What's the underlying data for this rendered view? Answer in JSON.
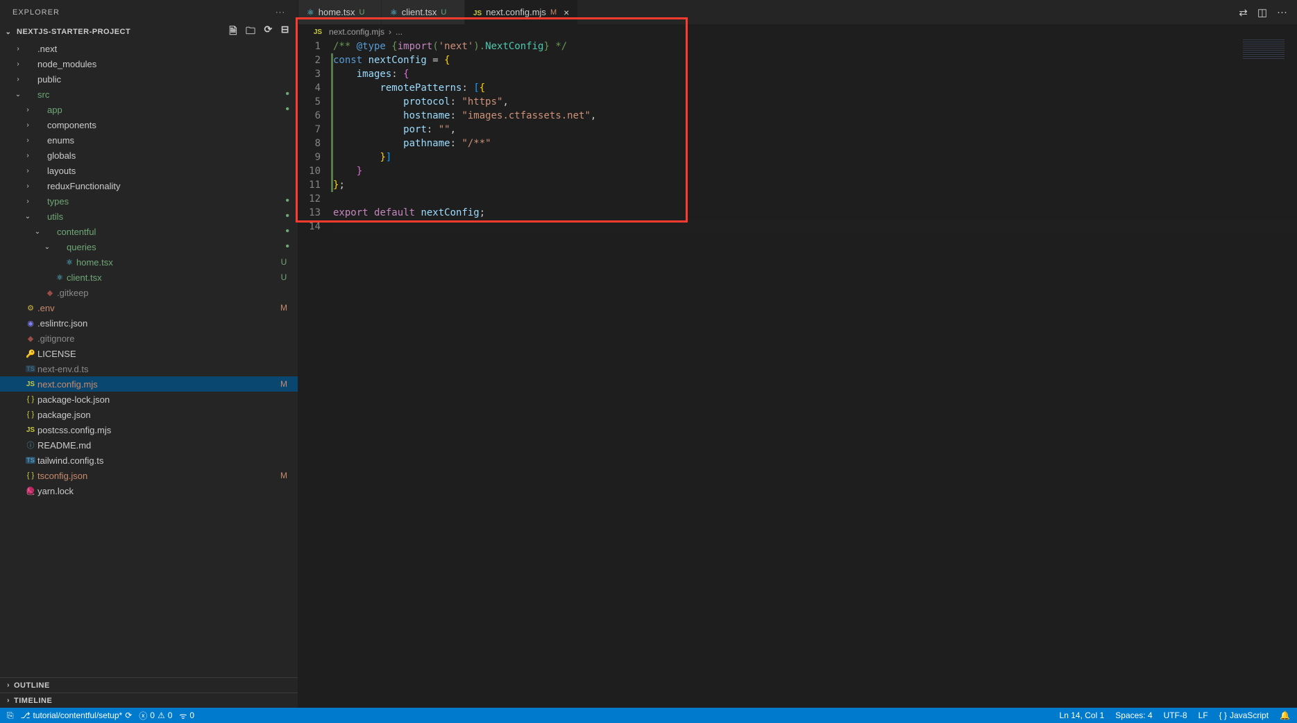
{
  "explorer": {
    "title": "EXPLORER"
  },
  "project": {
    "name": "NEXTJS-STARTER-PROJECT"
  },
  "tree": [
    {
      "indent": 1,
      "chev": "›",
      "icon": "",
      "label": ".next",
      "badge": "",
      "dot": false
    },
    {
      "indent": 1,
      "chev": "›",
      "icon": "",
      "label": "node_modules",
      "badge": "",
      "dot": false
    },
    {
      "indent": 1,
      "chev": "›",
      "icon": "",
      "label": "public",
      "badge": "",
      "dot": false
    },
    {
      "indent": 1,
      "chev": "⌄",
      "icon": "",
      "label": "src",
      "badge": "",
      "dot": true
    },
    {
      "indent": 2,
      "chev": "›",
      "icon": "",
      "label": "app",
      "badge": "",
      "dot": true
    },
    {
      "indent": 2,
      "chev": "›",
      "icon": "",
      "label": "components",
      "badge": "",
      "dot": false
    },
    {
      "indent": 2,
      "chev": "›",
      "icon": "",
      "label": "enums",
      "badge": "",
      "dot": false
    },
    {
      "indent": 2,
      "chev": "›",
      "icon": "",
      "label": "globals",
      "badge": "",
      "dot": false
    },
    {
      "indent": 2,
      "chev": "›",
      "icon": "",
      "label": "layouts",
      "badge": "",
      "dot": false
    },
    {
      "indent": 2,
      "chev": "›",
      "icon": "",
      "label": "reduxFunctionality",
      "badge": "",
      "dot": false
    },
    {
      "indent": 2,
      "chev": "›",
      "icon": "",
      "label": "types",
      "badge": "",
      "dot": true
    },
    {
      "indent": 2,
      "chev": "⌄",
      "icon": "",
      "label": "utils",
      "badge": "",
      "dot": true
    },
    {
      "indent": 3,
      "chev": "⌄",
      "icon": "",
      "label": "contentful",
      "badge": "",
      "dot": true
    },
    {
      "indent": 4,
      "chev": "⌄",
      "icon": "",
      "label": "queries",
      "badge": "",
      "dot": true
    },
    {
      "indent": 5,
      "chev": "",
      "icon": "react",
      "label": "home.tsx",
      "badge": "U",
      "dot": false
    },
    {
      "indent": 4,
      "chev": "",
      "icon": "react",
      "label": "client.tsx",
      "badge": "U",
      "dot": false
    },
    {
      "indent": 3,
      "chev": "",
      "icon": "git",
      "label": ".gitkeep",
      "badge": "",
      "dot": false,
      "muted": true
    },
    {
      "indent": 1,
      "chev": "",
      "icon": "env",
      "label": ".env",
      "badge": "M",
      "dot": false
    },
    {
      "indent": 1,
      "chev": "",
      "icon": "eslint",
      "label": ".eslintrc.json",
      "badge": "",
      "dot": false
    },
    {
      "indent": 1,
      "chev": "",
      "icon": "git",
      "label": ".gitignore",
      "badge": "",
      "dot": false,
      "muted": true
    },
    {
      "indent": 1,
      "chev": "",
      "icon": "lic",
      "label": "LICENSE",
      "badge": "",
      "dot": false
    },
    {
      "indent": 1,
      "chev": "",
      "icon": "ts",
      "label": "next-env.d.ts",
      "badge": "",
      "dot": false,
      "muted": true
    },
    {
      "indent": 1,
      "chev": "",
      "icon": "js",
      "label": "next.config.mjs",
      "badge": "M",
      "dot": false,
      "selected": true
    },
    {
      "indent": 1,
      "chev": "",
      "icon": "json",
      "label": "package-lock.json",
      "badge": "",
      "dot": false
    },
    {
      "indent": 1,
      "chev": "",
      "icon": "json",
      "label": "package.json",
      "badge": "",
      "dot": false
    },
    {
      "indent": 1,
      "chev": "",
      "icon": "js",
      "label": "postcss.config.mjs",
      "badge": "",
      "dot": false
    },
    {
      "indent": 1,
      "chev": "",
      "icon": "md",
      "label": "README.md",
      "badge": "",
      "dot": false
    },
    {
      "indent": 1,
      "chev": "",
      "icon": "ts",
      "label": "tailwind.config.ts",
      "badge": "",
      "dot": false
    },
    {
      "indent": 1,
      "chev": "",
      "icon": "json",
      "label": "tsconfig.json",
      "badge": "M",
      "dot": false
    },
    {
      "indent": 1,
      "chev": "",
      "icon": "yarn",
      "label": "yarn.lock",
      "badge": "",
      "dot": false
    }
  ],
  "panels": {
    "outline": "OUTLINE",
    "timeline": "TIMELINE"
  },
  "tabs": [
    {
      "icon": "react",
      "label": "home.tsx",
      "status": "U",
      "active": false,
      "close": false
    },
    {
      "icon": "react",
      "label": "client.tsx",
      "status": "U",
      "active": false,
      "close": false
    },
    {
      "icon": "js",
      "label": "next.config.mjs",
      "status": "M",
      "active": true,
      "close": true
    }
  ],
  "breadcrumb": {
    "file": "next.config.mjs",
    "rest": "..."
  },
  "code": {
    "lines": [
      "1",
      "2",
      "3",
      "4",
      "5",
      "6",
      "7",
      "8",
      "9",
      "10",
      "11",
      "12",
      "13",
      "14"
    ],
    "l1a": "/** ",
    "l1b": "@type",
    "l1c": " {",
    "l1d": "import",
    "l1e": "(",
    "l1f": "'next'",
    "l1g": ").",
    "l1h": "NextConfig",
    "l1i": "}",
    "l1j": " */",
    "l2a": "const ",
    "l2b": "nextConfig",
    "l2c": " = ",
    "l2d": "{",
    "l3a": "    ",
    "l3b": "images",
    "l3c": ": ",
    "l3d": "{",
    "l4a": "        ",
    "l4b": "remotePatterns",
    "l4c": ": ",
    "l4d": "[",
    "l4e": "{",
    "l5a": "            ",
    "l5b": "protocol",
    "l5c": ": ",
    "l5d": "\"https\"",
    "l5e": ",",
    "l6a": "            ",
    "l6b": "hostname",
    "l6c": ": ",
    "l6d": "\"images.ctfassets.net\"",
    "l6e": ",",
    "l7a": "            ",
    "l7b": "port",
    "l7c": ": ",
    "l7d": "\"\"",
    "l7e": ",",
    "l8a": "            ",
    "l8b": "pathname",
    "l8c": ": ",
    "l8d": "\"/**\"",
    "l9a": "        ",
    "l9b": "}",
    "l9c": "]",
    "l10a": "    ",
    "l10b": "}",
    "l11a": "}",
    "l11b": ";",
    "l12": "",
    "l13a": "export ",
    "l13b": "default ",
    "l13c": "nextConfig",
    "l13d": ";",
    "l14": ""
  },
  "status": {
    "branch": "tutorial/contentful/setup*",
    "sync": "⟳",
    "errors": "0",
    "warnings": "0",
    "ports": "0",
    "lncol": "Ln 14, Col 1",
    "spaces": "Spaces: 4",
    "encoding": "UTF-8",
    "eol": "LF",
    "lang": "JavaScript"
  }
}
